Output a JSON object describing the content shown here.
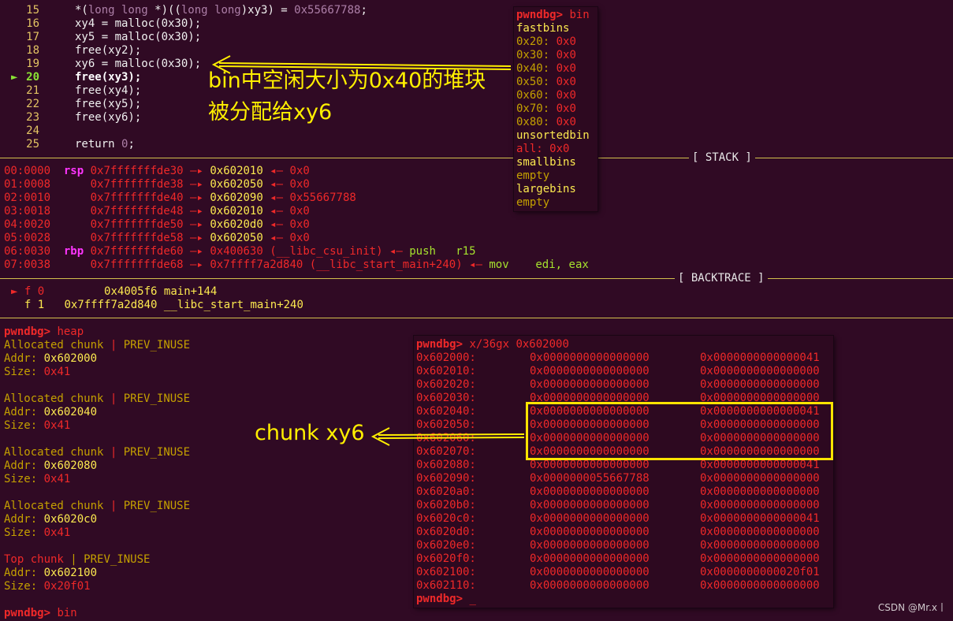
{
  "source": {
    "lines": [
      {
        "no": "15",
        "text": "*(long long *)((long long)xy3) = 0x55667788;"
      },
      {
        "no": "16",
        "text": "xy4 = malloc(0x30);"
      },
      {
        "no": "17",
        "text": "xy5 = malloc(0x30);"
      },
      {
        "no": "18",
        "text": "free(xy2);"
      },
      {
        "no": "19",
        "text": "xy6 = malloc(0x30);"
      },
      {
        "no": "20",
        "text": "free(xy3);"
      },
      {
        "no": "21",
        "text": "free(xy4);"
      },
      {
        "no": "22",
        "text": "free(xy5);"
      },
      {
        "no": "23",
        "text": "free(xy6);"
      },
      {
        "no": "24",
        "text": ""
      },
      {
        "no": "25",
        "text": "return 0;"
      }
    ],
    "current_marker": "►"
  },
  "stack_header": "[ STACK ]",
  "stack": [
    {
      "off": "00:0000",
      "reg": "rsp",
      "addr": "0x7fffffffde30",
      "v1": "0x602010",
      "v2": "0x0"
    },
    {
      "off": "01:0008",
      "reg": "",
      "addr": "0x7fffffffde38",
      "v1": "0x602050",
      "v2": "0x0"
    },
    {
      "off": "02:0010",
      "reg": "",
      "addr": "0x7fffffffde40",
      "v1": "0x602090",
      "v2": "0x55667788"
    },
    {
      "off": "03:0018",
      "reg": "",
      "addr": "0x7fffffffde48",
      "v1": "0x602010",
      "v2": "0x0"
    },
    {
      "off": "04:0020",
      "reg": "",
      "addr": "0x7fffffffde50",
      "v1": "0x6020d0",
      "v2": "0x0"
    },
    {
      "off": "05:0028",
      "reg": "",
      "addr": "0x7fffffffde58",
      "v1": "0x602050",
      "v2": "0x0"
    },
    {
      "off": "06:0030",
      "reg": "rbp",
      "addr": "0x7fffffffde60",
      "v1": "0x400630 (__libc_csu_init)",
      "v2": "push   r15"
    },
    {
      "off": "07:0038",
      "reg": "",
      "addr": "0x7fffffffde68",
      "v1": "0x7ffff7a2d840 (__libc_start_main+240)",
      "v2": "mov    edi, eax"
    }
  ],
  "backtrace_header": "[ BACKTRACE ]",
  "backtrace": [
    {
      "frame": "f 0",
      "addr": "0x4005f6",
      "sym": "main+144"
    },
    {
      "frame": "f 1",
      "addr": "0x7ffff7a2d840",
      "sym": "__libc_start_main+240"
    }
  ],
  "heap": {
    "prompt": "pwndbg>",
    "cmd": "heap",
    "chunks": [
      {
        "type": "Allocated chunk",
        "flag": "PREV_INUSE",
        "addr": "0x602000",
        "size": "0x41"
      },
      {
        "type": "Allocated chunk",
        "flag": "PREV_INUSE",
        "addr": "0x602040",
        "size": "0x41"
      },
      {
        "type": "Allocated chunk",
        "flag": "PREV_INUSE",
        "addr": "0x602080",
        "size": "0x41"
      },
      {
        "type": "Allocated chunk",
        "flag": "PREV_INUSE",
        "addr": "0x6020c0",
        "size": "0x41"
      },
      {
        "type": "Top chunk",
        "flag": "PREV_INUSE",
        "addr": "0x602100",
        "size": "0x20f01"
      }
    ],
    "next_cmd": "bin"
  },
  "bins_panel": {
    "prompt": "pwndbg>",
    "cmd": "bin",
    "fastbins_label": "fastbins",
    "fastbins": [
      {
        "size": "0x20:",
        "val": "0x0"
      },
      {
        "size": "0x30:",
        "val": "0x0"
      },
      {
        "size": "0x40:",
        "val": "0x0"
      },
      {
        "size": "0x50:",
        "val": "0x0"
      },
      {
        "size": "0x60:",
        "val": "0x0"
      },
      {
        "size": "0x70:",
        "val": "0x0"
      },
      {
        "size": "0x80:",
        "val": "0x0"
      }
    ],
    "unsorted_label": "unsortedbin",
    "unsorted_all": "all:",
    "unsorted_val": "0x0",
    "small_label": "smallbins",
    "small_val": "empty",
    "large_label": "largebins",
    "large_val": "empty"
  },
  "mem_panel": {
    "prompt": "pwndbg>",
    "cmd": "x/36gx 0x602000",
    "rows": [
      {
        "a": "0x602000:",
        "q1": "0x0000000000000000",
        "q2": "0x0000000000000041"
      },
      {
        "a": "0x602010:",
        "q1": "0x0000000000000000",
        "q2": "0x0000000000000000"
      },
      {
        "a": "0x602020:",
        "q1": "0x0000000000000000",
        "q2": "0x0000000000000000"
      },
      {
        "a": "0x602030:",
        "q1": "0x0000000000000000",
        "q2": "0x0000000000000000"
      },
      {
        "a": "0x602040:",
        "q1": "0x0000000000000000",
        "q2": "0x0000000000000041"
      },
      {
        "a": "0x602050:",
        "q1": "0x0000000000000000",
        "q2": "0x0000000000000000"
      },
      {
        "a": "0x602060:",
        "q1": "0x0000000000000000",
        "q2": "0x0000000000000000"
      },
      {
        "a": "0x602070:",
        "q1": "0x0000000000000000",
        "q2": "0x0000000000000000"
      },
      {
        "a": "0x602080:",
        "q1": "0x0000000000000000",
        "q2": "0x0000000000000041"
      },
      {
        "a": "0x602090:",
        "q1": "0x0000000055667788",
        "q2": "0x0000000000000000"
      },
      {
        "a": "0x6020a0:",
        "q1": "0x0000000000000000",
        "q2": "0x0000000000000000"
      },
      {
        "a": "0x6020b0:",
        "q1": "0x0000000000000000",
        "q2": "0x0000000000000000"
      },
      {
        "a": "0x6020c0:",
        "q1": "0x0000000000000000",
        "q2": "0x0000000000000041"
      },
      {
        "a": "0x6020d0:",
        "q1": "0x0000000000000000",
        "q2": "0x0000000000000000"
      },
      {
        "a": "0x6020e0:",
        "q1": "0x0000000000000000",
        "q2": "0x0000000000000000"
      },
      {
        "a": "0x6020f0:",
        "q1": "0x0000000000000000",
        "q2": "0x0000000000000000"
      },
      {
        "a": "0x602100:",
        "q1": "0x0000000000000000",
        "q2": "0x0000000000020f01"
      },
      {
        "a": "0x602110:",
        "q1": "0x0000000000000000",
        "q2": "0x0000000000000000"
      }
    ],
    "end_prompt": "pwndbg>",
    "cursor": "_"
  },
  "annotations": {
    "bin_line1": "bin中空闲大小为0x40的堆块",
    "bin_line2": "被分配给xy6",
    "chunk_label": "chunk xy6"
  },
  "watermark": "CSDN @Mr.x丨"
}
